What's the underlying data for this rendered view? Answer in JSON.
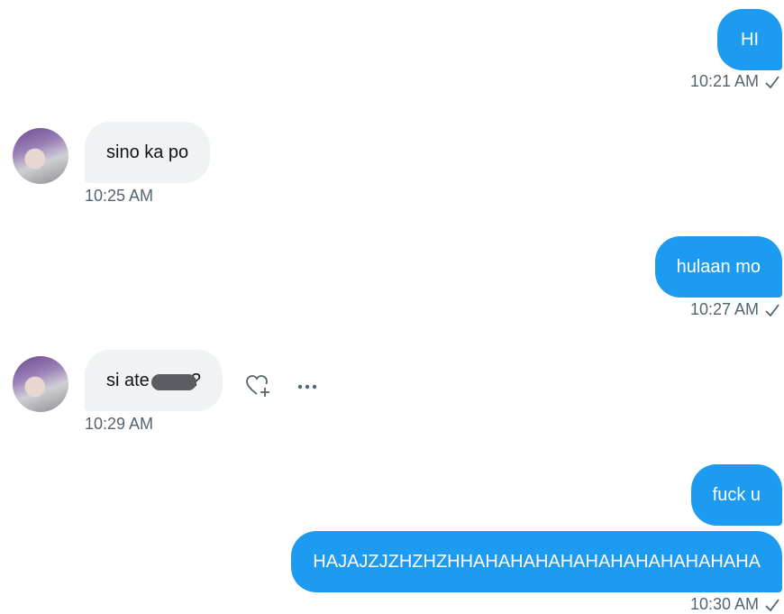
{
  "messages": [
    {
      "text": "HI",
      "time": "10:21 AM"
    },
    {
      "text": "sino ka po",
      "time": "10:25 AM"
    },
    {
      "text": "hulaan mo",
      "time": "10:27 AM"
    },
    {
      "text": "si ate",
      "suffix": "?",
      "time": "10:29 AM"
    },
    {
      "text": "fuck u"
    },
    {
      "text": "HAJAJZJZHZHZHHAHAHAHAHAHAHAHAHAHAHAHA",
      "time": "10:30 AM"
    }
  ],
  "icons": {
    "read_receipt": "check-icon",
    "react": "heart-plus-icon",
    "more": "more-icon"
  },
  "colors": {
    "sent_bubble": "#1d9bf0",
    "received_bubble": "#eff3f4",
    "timestamp": "#536471"
  }
}
